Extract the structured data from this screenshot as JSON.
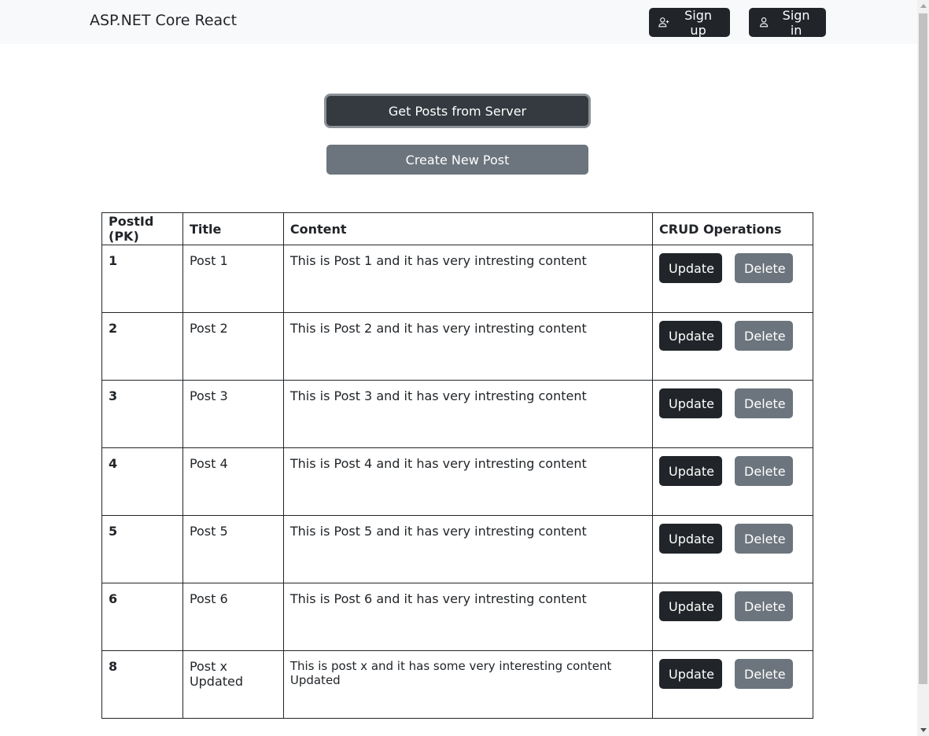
{
  "navbar": {
    "brand": "ASP.NET Core React",
    "signup_label": "Sign up",
    "signin_label": "Sign in"
  },
  "actions": {
    "get_posts_label": "Get Posts from Server",
    "create_post_label": "Create New Post"
  },
  "table": {
    "headers": [
      "PostId (PK)",
      "Title",
      "Content",
      "CRUD Operations"
    ],
    "rows": [
      {
        "id": "1",
        "title": "Post 1",
        "content": "This is Post 1 and it has very intresting content",
        "update": "Update",
        "delete": "Delete"
      },
      {
        "id": "2",
        "title": "Post 2",
        "content": "This is Post 2 and it has very intresting content",
        "update": "Update",
        "delete": "Delete"
      },
      {
        "id": "3",
        "title": "Post 3",
        "content": "This is Post 3 and it has very intresting content",
        "update": "Update",
        "delete": "Delete"
      },
      {
        "id": "4",
        "title": "Post 4",
        "content": "This is Post 4 and it has very intresting content",
        "update": "Update",
        "delete": "Delete"
      },
      {
        "id": "5",
        "title": "Post 5",
        "content": "This is Post 5 and it has very intresting content",
        "update": "Update",
        "delete": "Delete"
      },
      {
        "id": "6",
        "title": "Post 6",
        "content": "This is Post 6 and it has very intresting content",
        "update": "Update",
        "delete": "Delete"
      },
      {
        "id": "8",
        "title": "Post x Updated",
        "content": "This is post x and it has some very interesting content Updated",
        "update": "Update",
        "delete": "Delete"
      }
    ]
  },
  "icons": {
    "signup": "person-plus-icon",
    "signin": "person-icon"
  },
  "colors": {
    "dark": "#212529",
    "secondary": "#6c757d",
    "navbar_bg": "#f8f9fa"
  }
}
